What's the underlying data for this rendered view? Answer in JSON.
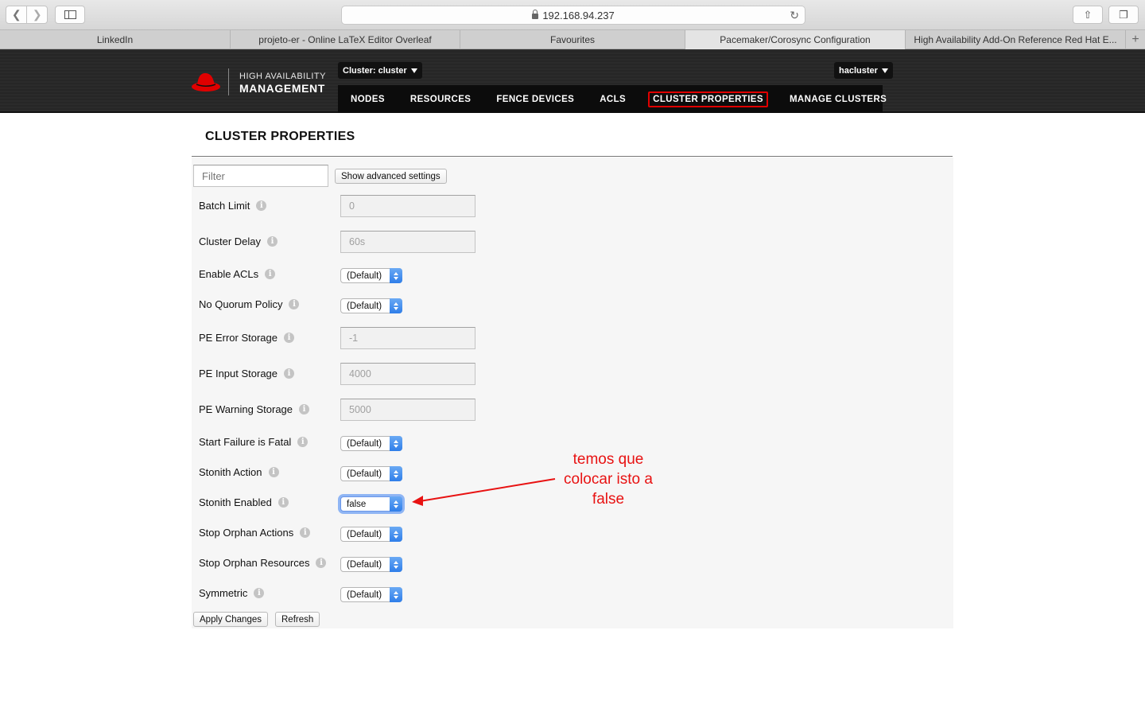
{
  "browser": {
    "url": "192.168.94.237",
    "tabs": [
      {
        "label": "LinkedIn"
      },
      {
        "label": "projeto-er - Online LaTeX Editor Overleaf"
      },
      {
        "label": "Favourites"
      },
      {
        "label": "Pacemaker/Corosync Configuration"
      },
      {
        "label": "High Availability Add-On Reference Red Hat E..."
      }
    ]
  },
  "header": {
    "brand_top": "HIGH AVAILABILITY",
    "brand_bottom": "MANAGEMENT",
    "cluster_dropdown": "Cluster: cluster",
    "user_dropdown": "hacluster",
    "logo_color": "#e00000",
    "nav": [
      {
        "label": "NODES"
      },
      {
        "label": "RESOURCES"
      },
      {
        "label": "FENCE DEVICES"
      },
      {
        "label": "ACLS"
      },
      {
        "label": "CLUSTER PROPERTIES"
      },
      {
        "label": "MANAGE CLUSTERS"
      }
    ]
  },
  "page": {
    "title": "CLUSTER PROPERTIES",
    "filter_placeholder": "Filter",
    "advanced_button": "Show advanced settings",
    "apply_button": "Apply Changes",
    "refresh_button": "Refresh"
  },
  "properties": [
    {
      "label": "Batch Limit",
      "value": "0"
    },
    {
      "label": "Cluster Delay",
      "value": "60s"
    },
    {
      "label": "Enable ACLs",
      "value": "(Default)"
    },
    {
      "label": "No Quorum Policy",
      "value": "(Default)"
    },
    {
      "label": "PE Error Storage",
      "value": "-1"
    },
    {
      "label": "PE Input Storage",
      "value": "4000"
    },
    {
      "label": "PE Warning Storage",
      "value": "5000"
    },
    {
      "label": "Start Failure is Fatal",
      "value": "(Default)"
    },
    {
      "label": "Stonith Action",
      "value": "(Default)"
    },
    {
      "label": "Stonith Enabled",
      "value": "false"
    },
    {
      "label": "Stop Orphan Actions",
      "value": "(Default)"
    },
    {
      "label": "Stop Orphan Resources",
      "value": "(Default)"
    },
    {
      "label": "Symmetric",
      "value": "(Default)"
    }
  ],
  "annotation": {
    "line1": "temos que",
    "line2": "colocar isto a",
    "line3": "false",
    "color": "#e81212"
  },
  "icons": {
    "info": "i"
  }
}
